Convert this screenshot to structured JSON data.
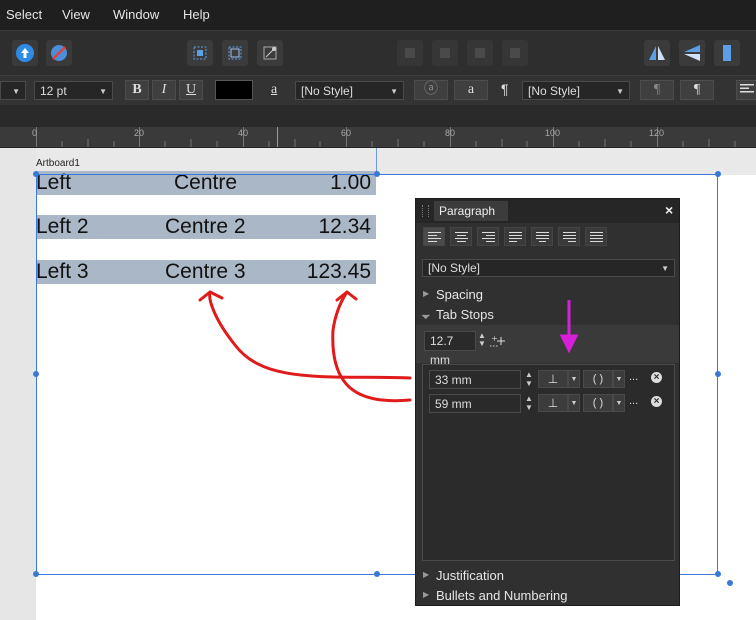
{
  "menu": [
    "Select",
    "View",
    "Window",
    "Help"
  ],
  "context_toolbar": {
    "font_size": "12 pt",
    "bold": "B",
    "italic": "I",
    "underline": "U",
    "text_color": "#000000",
    "char_style_glyph": "a",
    "char_style": "[No Style]",
    "para_glyph": "¶",
    "para_style": "[No Style]"
  },
  "ruler": {
    "labels": [
      "0",
      "20",
      "40",
      "60",
      "80",
      "100",
      "120"
    ]
  },
  "artboard": {
    "name": "Artboard1"
  },
  "document_rows": [
    {
      "left": "Left",
      "centre": "Centre",
      "right": "1.00"
    },
    {
      "left": "Left 2",
      "centre": "Centre 2",
      "right": "12.34"
    },
    {
      "left": "Left 3",
      "centre": "Centre 3",
      "right": "123.45"
    }
  ],
  "panel": {
    "title": "Paragraph",
    "close": "×",
    "style_select": "[No Style]",
    "sections": {
      "spacing": "Spacing",
      "tab_stops": "Tab Stops",
      "justification": "Justification",
      "bullets": "Bullets and Numbering"
    },
    "default_tab": "12.7 mm",
    "tab_stops": [
      {
        "position": "33 mm",
        "type_icon": "⊥",
        "leader": "( )",
        "more": "..."
      },
      {
        "position": "59 mm",
        "type_icon": "⊥",
        "leader": "( )",
        "more": "..."
      }
    ]
  },
  "annotation_colors": {
    "arrows": "#e01b1b",
    "marker": "#d61fd6"
  }
}
